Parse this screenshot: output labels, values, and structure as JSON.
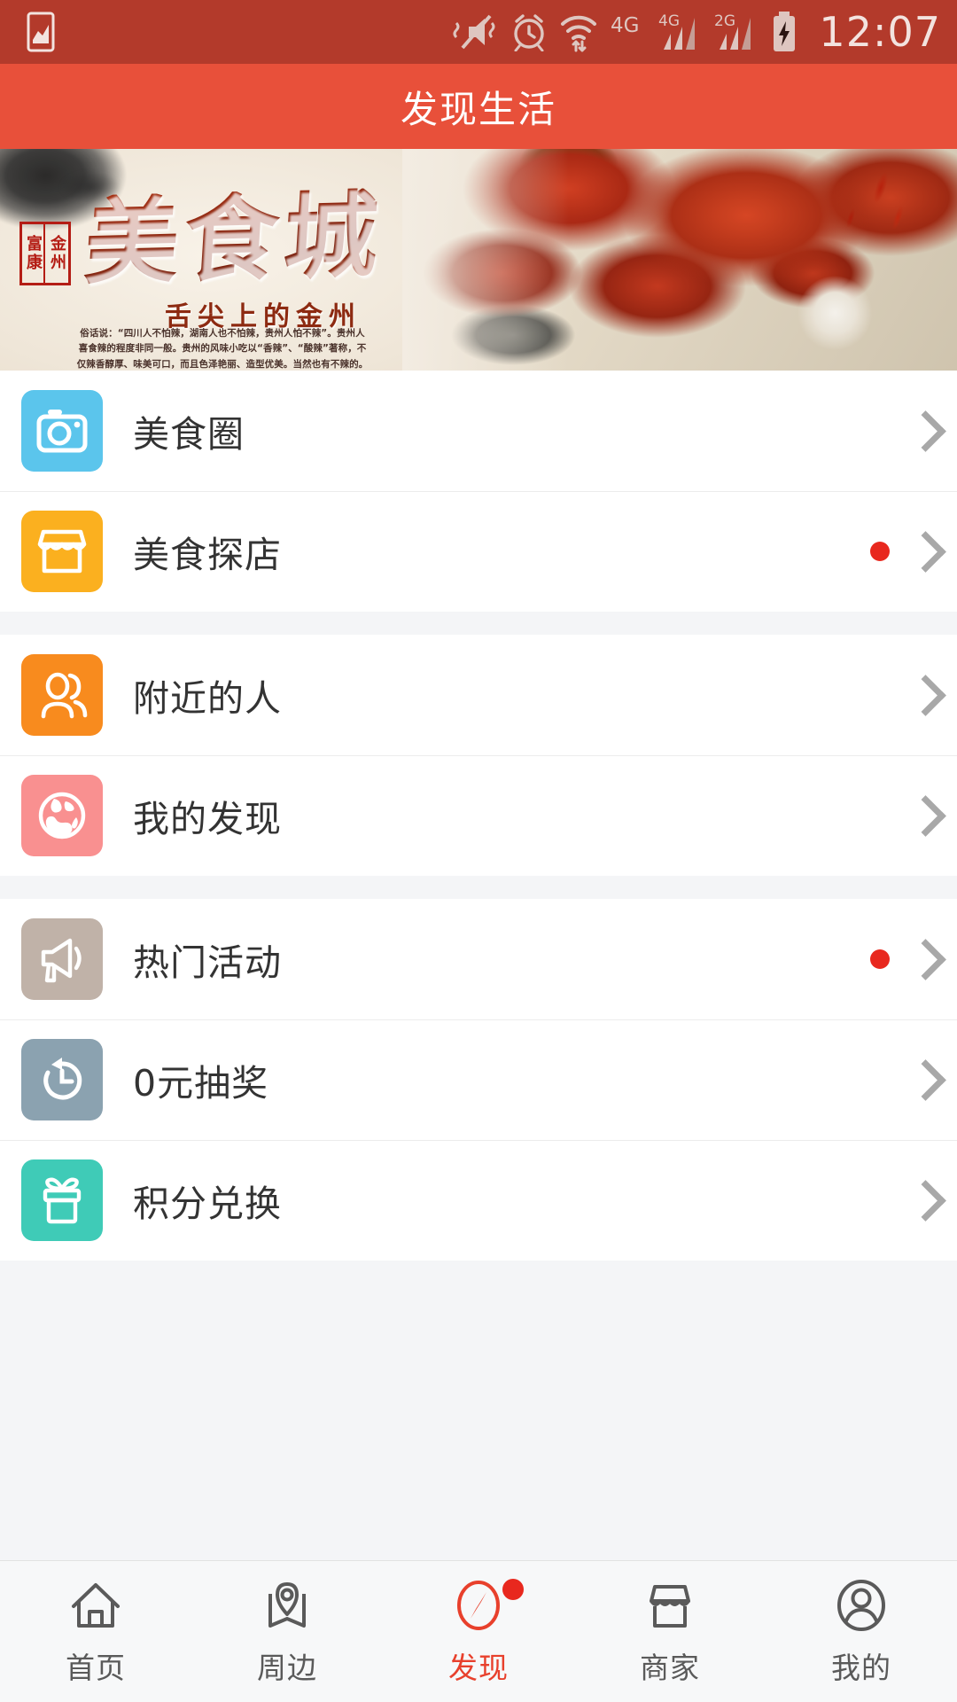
{
  "statusbar": {
    "time": "12:07",
    "icons": [
      "screenshot-icon",
      "mute-vibrate-icon",
      "alarm-icon",
      "wifi-icon",
      "4g-data-icon",
      "signal-4g-icon",
      "signal-2g-icon",
      "battery-charging-icon"
    ]
  },
  "header": {
    "title": "发现生活",
    "bar_color": "#e8503a",
    "status_color": "#b33a2b"
  },
  "banner": {
    "title": "美食城",
    "subtitle": "舌尖上的金州",
    "seal_right": "金州",
    "seal_left": "富康",
    "blurb": "俗话说：“四川人不怕辣，湖南人也不怕辣，贵州人怕不辣”。贵州人喜食辣的程度非同一般。贵州的风味小吃以“香辣”、“酸辣”著称，不仅辣香醇厚、味美可口，而且色泽艳丽、造型优美。当然也有不辣的。"
  },
  "menu": {
    "groups": [
      {
        "items": [
          {
            "label": "美食圈",
            "icon": "camera-icon",
            "color": "#5bc5ec",
            "badge": false
          },
          {
            "label": "美食探店",
            "icon": "storefront-icon",
            "color": "#fbb01f",
            "badge": true
          }
        ]
      },
      {
        "items": [
          {
            "label": "附近的人",
            "icon": "people-icon",
            "color": "#f88b1e",
            "badge": false
          },
          {
            "label": "我的发现",
            "icon": "globe-icon",
            "color": "#f99090",
            "badge": false
          }
        ]
      },
      {
        "items": [
          {
            "label": "热门活动",
            "icon": "megaphone-icon",
            "color": "#c0b2a8",
            "badge": true
          },
          {
            "label": "0元抽奖",
            "icon": "history-clock-icon",
            "color": "#8ba2b0",
            "badge": false
          },
          {
            "label": "积分兑换",
            "icon": "gift-icon",
            "color": "#3fcbb7",
            "badge": false
          }
        ]
      }
    ],
    "chevron_color": "#a8a8a8",
    "badge_color": "#e8281e"
  },
  "tabbar": {
    "active_color": "#e8402c",
    "inactive_color": "#5a5a5a",
    "tabs": [
      {
        "label": "首页",
        "icon": "home-icon",
        "active": false,
        "badge": false
      },
      {
        "label": "周边",
        "icon": "map-pin-icon",
        "active": false,
        "badge": false
      },
      {
        "label": "发现",
        "icon": "compass-icon",
        "active": true,
        "badge": true
      },
      {
        "label": "商家",
        "icon": "shop-icon",
        "active": false,
        "badge": false
      },
      {
        "label": "我的",
        "icon": "person-icon",
        "active": false,
        "badge": false
      }
    ]
  }
}
